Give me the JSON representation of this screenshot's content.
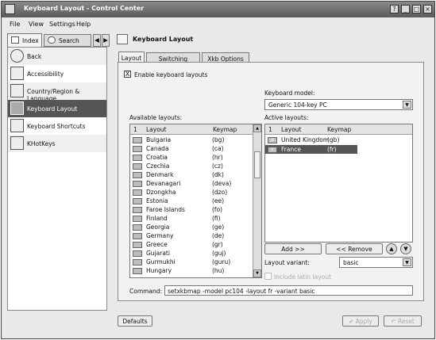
{
  "window": {
    "title": "Keyboard Layout - Control Center",
    "controls": [
      "?",
      "_",
      "□",
      "×"
    ]
  },
  "menu": [
    "File",
    "View",
    "Settings",
    "Help"
  ],
  "sidebar": {
    "tabs": [
      "Index",
      "Search"
    ],
    "items": [
      {
        "label": "Back",
        "icon": "back-arrow-icon"
      },
      {
        "label": "Accessibility",
        "icon": "accessibility-icon"
      },
      {
        "label": "Country/Region & Language",
        "icon": "country-icon"
      },
      {
        "label": "Keyboard Layout",
        "icon": "keyboard-layout-icon"
      },
      {
        "label": "Keyboard Shortcuts",
        "icon": "keyboard-shortcuts-icon"
      },
      {
        "label": "KHotKeys",
        "icon": "khotkeys-icon"
      }
    ],
    "selected": "Keyboard Layout"
  },
  "panel": {
    "title": "Keyboard Layout",
    "tabs": [
      "Layout",
      "Switching Options",
      "Xkb Options"
    ],
    "enable_label": "Enable keyboard layouts",
    "enable_checked": "X",
    "keyboard_model_label": "Keyboard model:",
    "keyboard_model_value": "Generic 104-key PC",
    "available_label": "Available layouts:",
    "active_label": "Active layouts:",
    "columns": {
      "num": "1",
      "layout": "Layout",
      "keymap": "Keymap"
    },
    "available_layouts": [
      {
        "name": "Bulgaria",
        "keymap": "(bg)"
      },
      {
        "name": "Canada",
        "keymap": "(ca)"
      },
      {
        "name": "Croatia",
        "keymap": "(hr)"
      },
      {
        "name": "Czechia",
        "keymap": "(cz)"
      },
      {
        "name": "Denmark",
        "keymap": "(dk)"
      },
      {
        "name": "Devanagari",
        "keymap": "(deva)"
      },
      {
        "name": "Dzongkha",
        "keymap": "(dzo)"
      },
      {
        "name": "Estonia",
        "keymap": "(ee)"
      },
      {
        "name": "Faroe Islands",
        "keymap": "(fo)"
      },
      {
        "name": "Finland",
        "keymap": "(fi)"
      },
      {
        "name": "Georgia",
        "keymap": "(ge)"
      },
      {
        "name": "Germany",
        "keymap": "(de)"
      },
      {
        "name": "Greece",
        "keymap": "(gr)"
      },
      {
        "name": "Gujarati",
        "keymap": "(guj)"
      },
      {
        "name": "Gurmukhi",
        "keymap": "(guru)"
      },
      {
        "name": "Hungary",
        "keymap": "(hu)"
      }
    ],
    "active_layouts": [
      {
        "name": "United Kingdom",
        "keymap": "(gb)",
        "flag": "gb"
      },
      {
        "name": "France",
        "keymap": "(fr)",
        "flag": "fr",
        "selected": true
      }
    ],
    "add_button": "Add >>",
    "remove_button": "<< Remove",
    "layout_variant_label": "Layout variant:",
    "layout_variant_value": "basic",
    "include_latin_label": "Include latin layout",
    "command_label": "Command:",
    "command_value": "setxkbmap -model pc104 -layout fr -variant basic"
  },
  "footer": {
    "defaults": "Defaults",
    "apply": "Apply",
    "reset": "Reset"
  }
}
